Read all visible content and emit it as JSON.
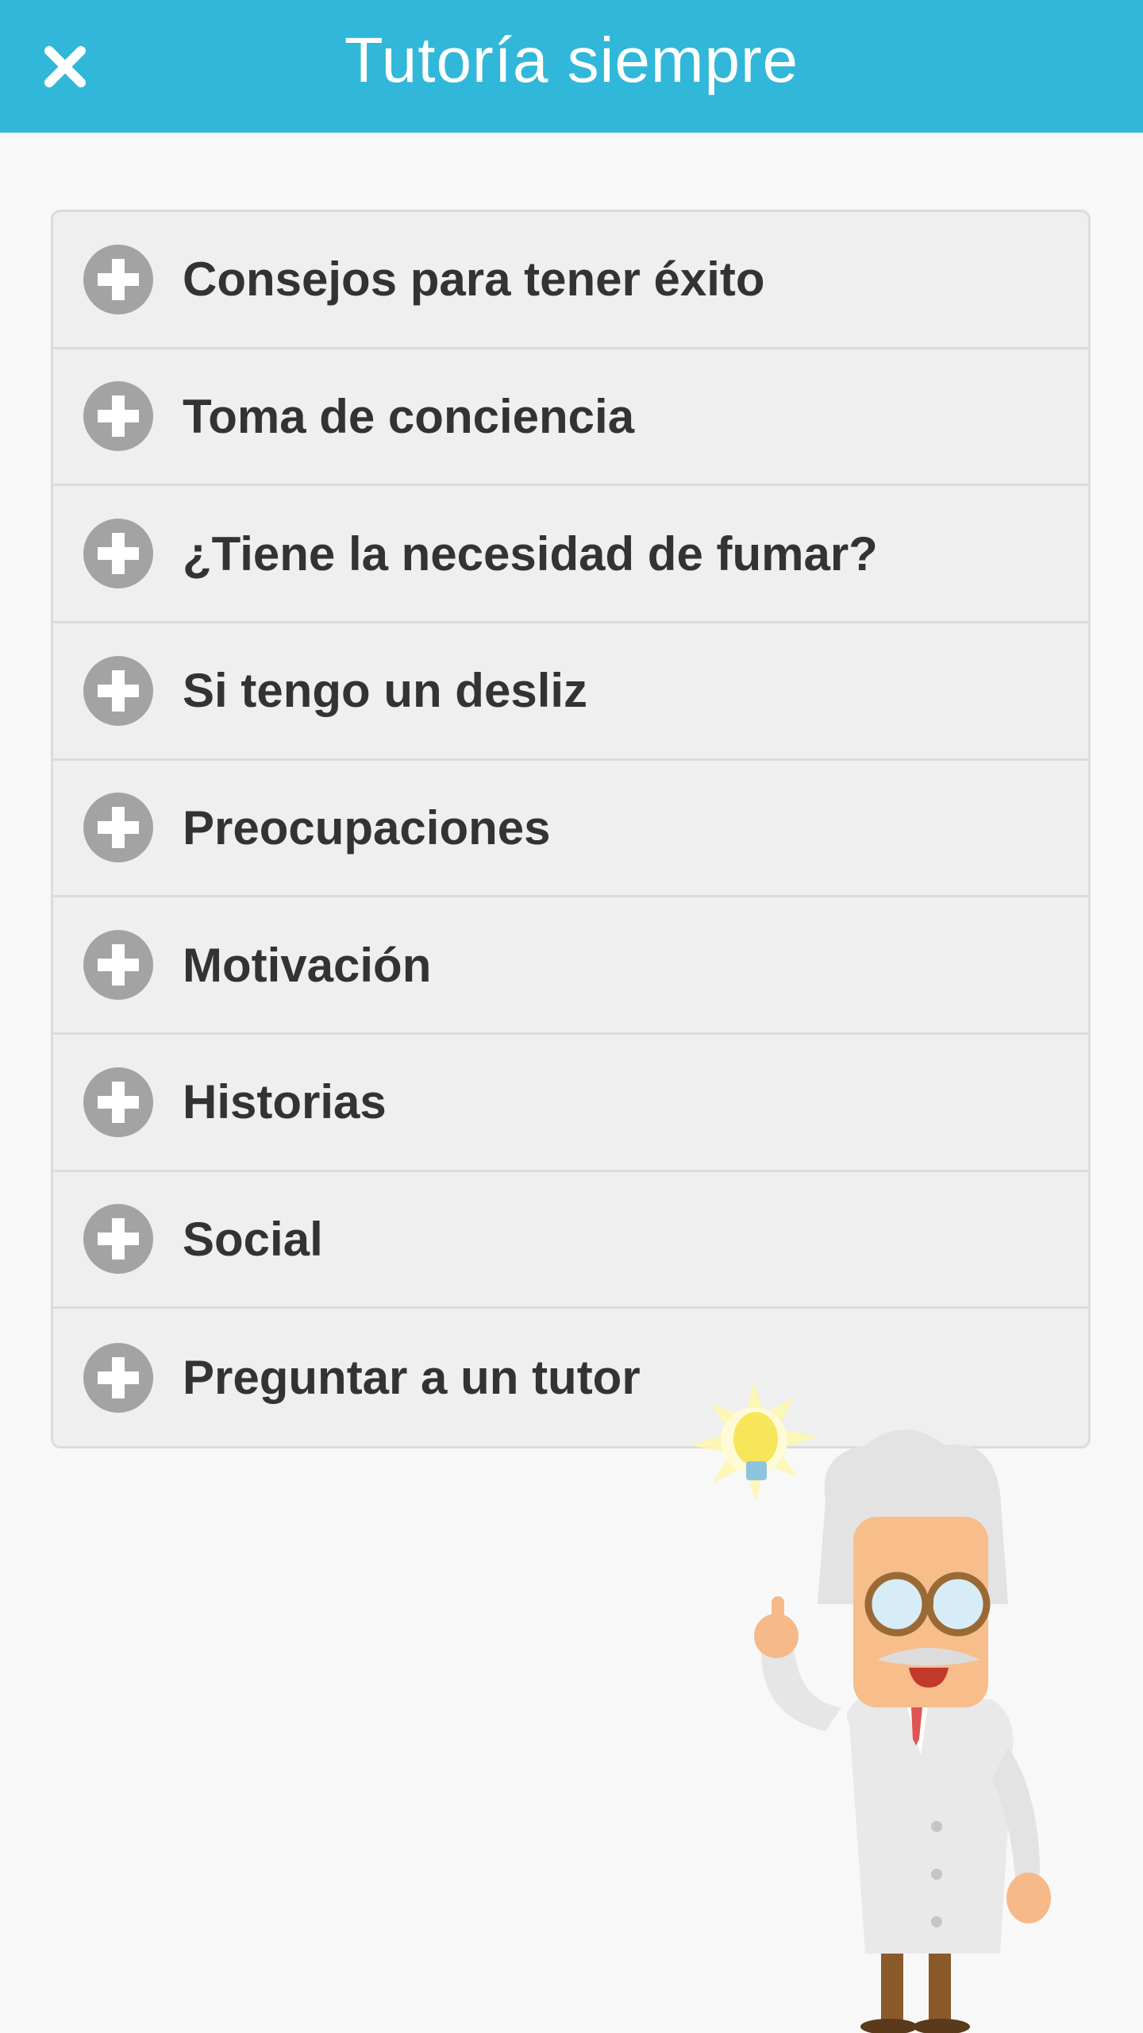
{
  "header": {
    "title": "Tutoría siempre",
    "close_icon": "close-icon",
    "background_color": "#31b7d9"
  },
  "accordion": {
    "expand_icon": "plus-circle-icon",
    "items": [
      {
        "label": "Consejos para tener éxito"
      },
      {
        "label": "Toma de conciencia"
      },
      {
        "label": "¿Tiene la necesidad de fumar?"
      },
      {
        "label": "Si tengo un desliz"
      },
      {
        "label": "Preocupaciones"
      },
      {
        "label": "Motivación"
      },
      {
        "label": "Historias"
      },
      {
        "label": "Social"
      },
      {
        "label": "Preguntar a un tutor"
      }
    ]
  },
  "illustration": {
    "name": "professor-with-lightbulb"
  }
}
